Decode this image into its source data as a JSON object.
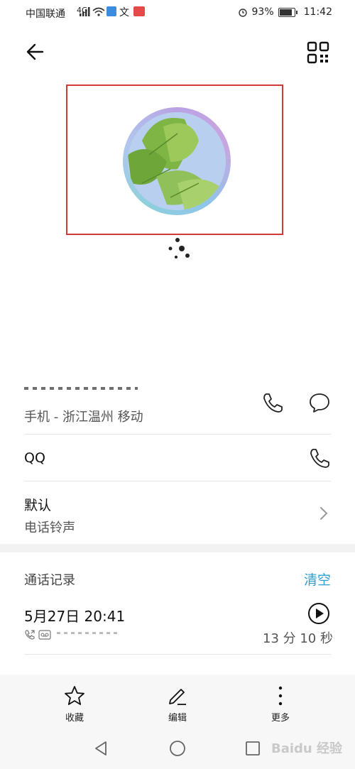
{
  "status_bar": {
    "carrier": "中国联通",
    "network": "4G",
    "battery": "93%",
    "time": "11:42"
  },
  "contact": {
    "phone_number_partial": "",
    "phone_label": "手机 - 浙江温州 移动",
    "qq_label": "QQ",
    "ringtone_value": "默认",
    "ringtone_label": "电话铃声"
  },
  "call_log": {
    "title": "通话记录",
    "clear_label": "清空",
    "entries": [
      {
        "datetime": "5月27日 20:41",
        "duration": "13 分 10 秒"
      }
    ]
  },
  "bottom_tabs": [
    {
      "label": "收藏",
      "icon": "star-icon"
    },
    {
      "label": "编辑",
      "icon": "pencil-icon"
    },
    {
      "label": "更多",
      "icon": "more-vertical-icon"
    }
  ],
  "watermark": "Baidu 经验",
  "colors": {
    "accent": "#2b9fd6",
    "highlight_box": "#d23a3a"
  }
}
